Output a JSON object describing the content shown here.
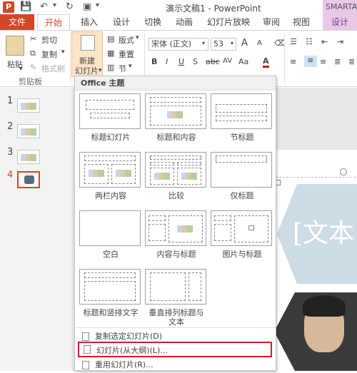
{
  "titlebar": {
    "app_icon": "P",
    "title": "演示文稿1 - PowerPoint",
    "context_tab": "SMARTA"
  },
  "tabs": [
    "文件",
    "开始",
    "插入",
    "设计",
    "切换",
    "动画",
    "幻灯片放映",
    "审阅",
    "视图",
    "设计"
  ],
  "ribbon": {
    "clipboard": {
      "paste": "粘贴",
      "cut": "剪切",
      "copy": "复制",
      "format_painter": "格式刷",
      "group_label": "剪贴板"
    },
    "slides": {
      "new_slide_line1": "新建",
      "new_slide_line2": "幻灯片",
      "layout": "版式",
      "reset": "重置",
      "section": "节"
    },
    "font": {
      "font_name": "宋体 (正文)",
      "font_size": "53",
      "bold": "B",
      "italic": "I",
      "underline": "U",
      "shadow": "S",
      "strike": "abc",
      "spacing": "AV",
      "case": "Aa",
      "color": "A",
      "grow": "A",
      "shrink": "A"
    }
  },
  "slides_panel": [
    {
      "num": "1"
    },
    {
      "num": "2"
    },
    {
      "num": "3"
    },
    {
      "num": "4"
    }
  ],
  "dropdown": {
    "header": "Office 主题",
    "layouts": [
      "标题幻灯片",
      "标题和内容",
      "节标题",
      "两栏内容",
      "比较",
      "仅标题",
      "空白",
      "内容与标题",
      "图片与标题",
      "标题和竖排文字",
      "垂直排列标题与",
      "文本"
    ],
    "commands": [
      "复制选定幻灯片(D)",
      "幻灯片(从大纲)(L)...",
      "重用幻灯片(R)..."
    ]
  },
  "slide_text": "[文本"
}
